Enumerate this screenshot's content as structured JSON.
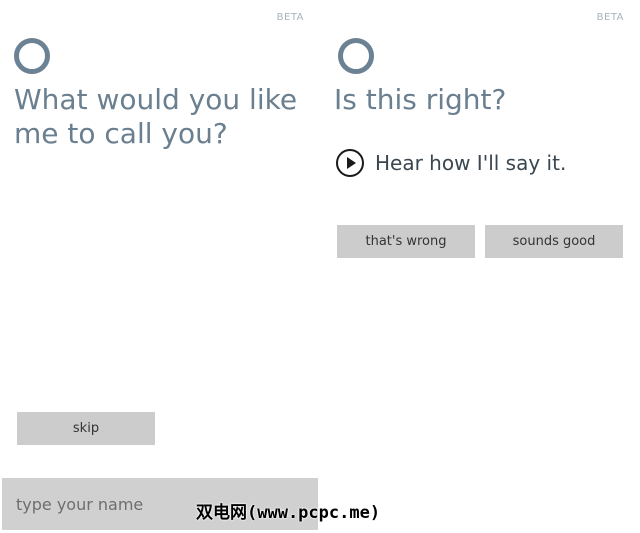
{
  "left_screen": {
    "beta_label": "BETA",
    "question": "What would you like me to call you?",
    "skip_button": "skip",
    "name_input": {
      "value": "",
      "placeholder": "type your name"
    }
  },
  "right_screen": {
    "beta_label": "BETA",
    "question": "Is this right?",
    "hear_label": "Hear how I'll say it.",
    "wrong_button": "that's wrong",
    "good_button": "sounds good"
  },
  "watermark": "双电网(www.pcpc.me)",
  "icons": {
    "assistant": "cortana-ring-icon",
    "play": "play-circle-icon"
  },
  "colors": {
    "accent": "#6b8194",
    "question_text": "#6a7f8f",
    "button_bg": "#cccccc",
    "input_bg": "#d0d0d0",
    "beta_text": "#a9b3bb"
  }
}
